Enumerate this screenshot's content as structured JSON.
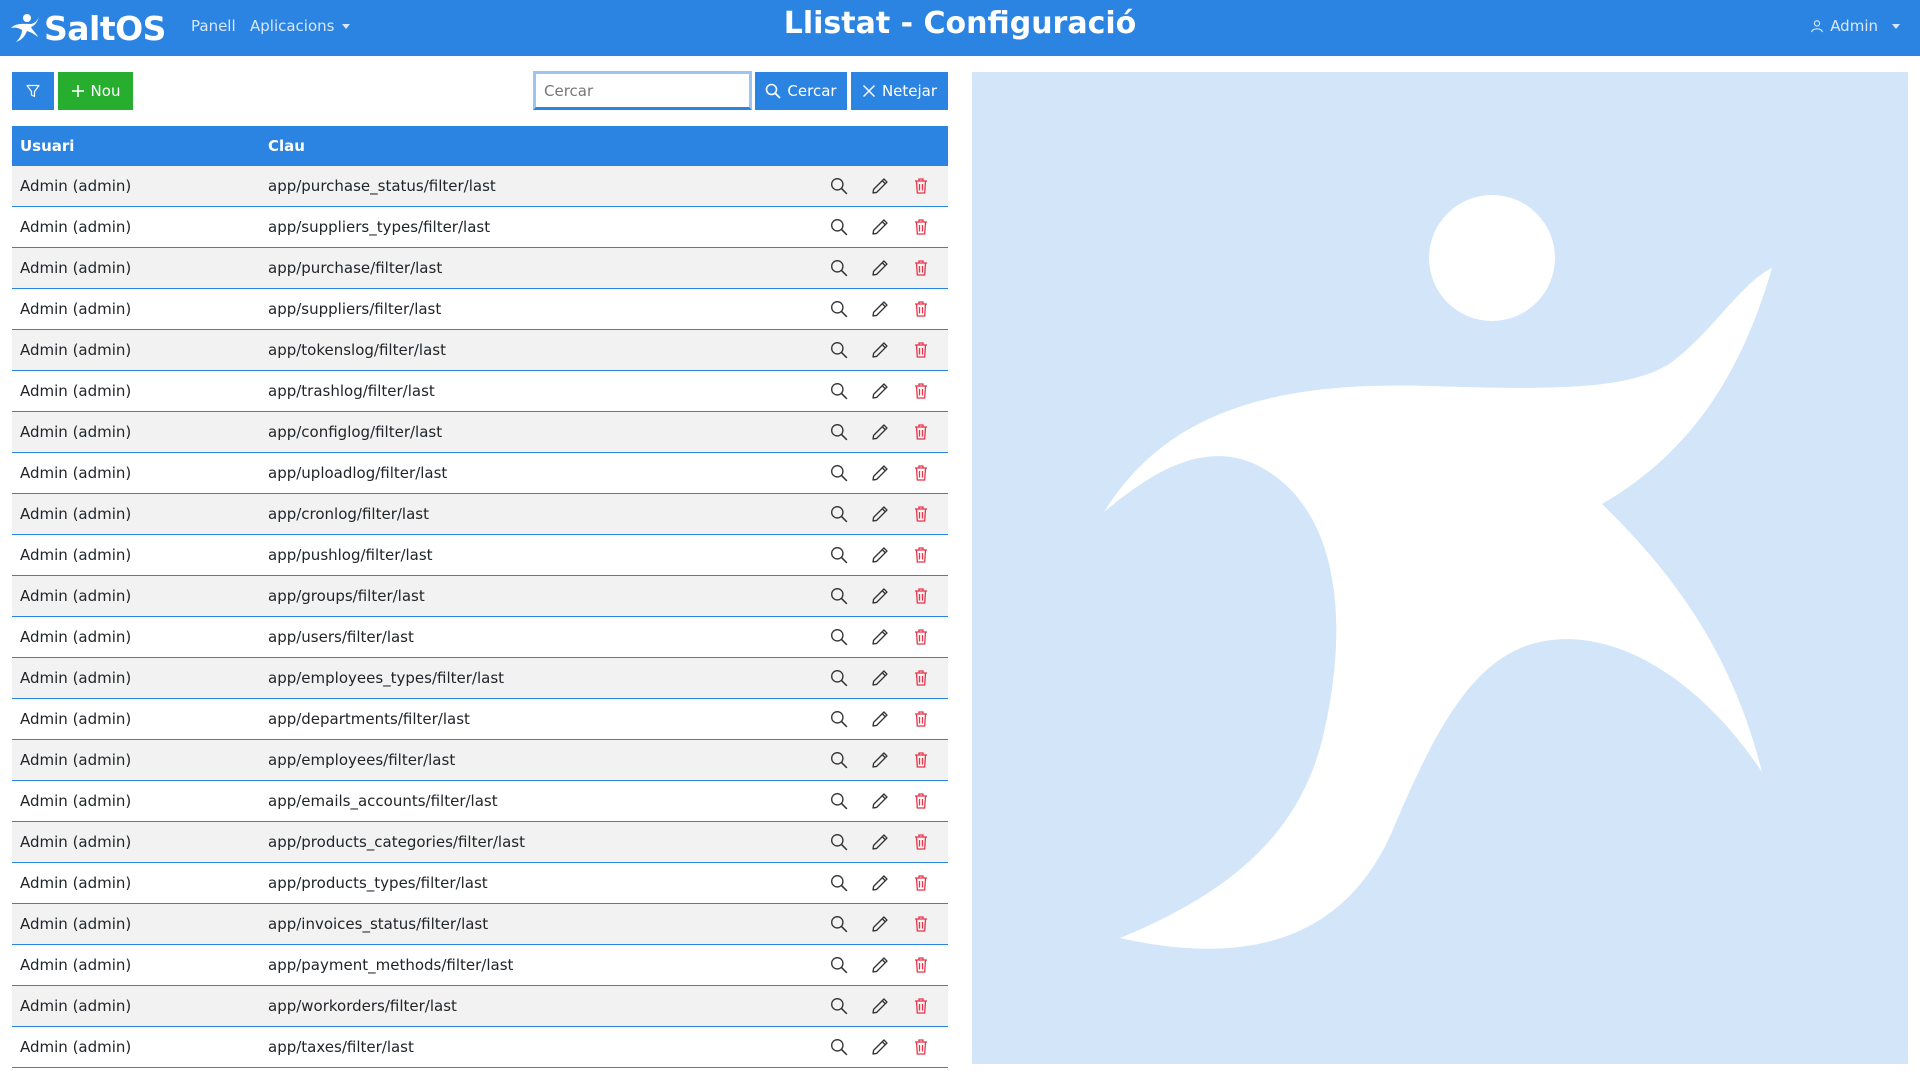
{
  "navbar": {
    "brand": "SaltOS",
    "links": [
      {
        "label": "Panell"
      },
      {
        "label": "Aplicacions"
      }
    ],
    "title": "Llistat - Configuració",
    "user": "Admin"
  },
  "toolbar": {
    "new_label": "Nou",
    "search_placeholder": "Cercar",
    "search_value": "",
    "search_label": "Cercar",
    "clear_label": "Netejar"
  },
  "table": {
    "columns": [
      "Usuari",
      "Clau"
    ],
    "rows": [
      {
        "user": "Admin (admin)",
        "key": "app/purchase_status/filter/last"
      },
      {
        "user": "Admin (admin)",
        "key": "app/suppliers_types/filter/last"
      },
      {
        "user": "Admin (admin)",
        "key": "app/purchase/filter/last"
      },
      {
        "user": "Admin (admin)",
        "key": "app/suppliers/filter/last"
      },
      {
        "user": "Admin (admin)",
        "key": "app/tokenslog/filter/last"
      },
      {
        "user": "Admin (admin)",
        "key": "app/trashlog/filter/last"
      },
      {
        "user": "Admin (admin)",
        "key": "app/configlog/filter/last"
      },
      {
        "user": "Admin (admin)",
        "key": "app/uploadlog/filter/last"
      },
      {
        "user": "Admin (admin)",
        "key": "app/cronlog/filter/last"
      },
      {
        "user": "Admin (admin)",
        "key": "app/pushlog/filter/last"
      },
      {
        "user": "Admin (admin)",
        "key": "app/groups/filter/last"
      },
      {
        "user": "Admin (admin)",
        "key": "app/users/filter/last"
      },
      {
        "user": "Admin (admin)",
        "key": "app/employees_types/filter/last"
      },
      {
        "user": "Admin (admin)",
        "key": "app/departments/filter/last"
      },
      {
        "user": "Admin (admin)",
        "key": "app/employees/filter/last"
      },
      {
        "user": "Admin (admin)",
        "key": "app/emails_accounts/filter/last"
      },
      {
        "user": "Admin (admin)",
        "key": "app/products_categories/filter/last"
      },
      {
        "user": "Admin (admin)",
        "key": "app/products_types/filter/last"
      },
      {
        "user": "Admin (admin)",
        "key": "app/invoices_status/filter/last"
      },
      {
        "user": "Admin (admin)",
        "key": "app/payment_methods/filter/last"
      },
      {
        "user": "Admin (admin)",
        "key": "app/workorders/filter/last"
      },
      {
        "user": "Admin (admin)",
        "key": "app/taxes/filter/last"
      }
    ]
  },
  "icons": {
    "view": "search-icon",
    "edit": "pencil-icon",
    "delete": "trash-icon",
    "filter": "funnel-icon",
    "new": "plus-icon",
    "clear": "x-icon",
    "user": "person-icon"
  },
  "colors": {
    "primary": "#2b84e2",
    "success": "#27ae2e",
    "danger": "#e8334a",
    "hero_bg": "#d2e5f9"
  }
}
